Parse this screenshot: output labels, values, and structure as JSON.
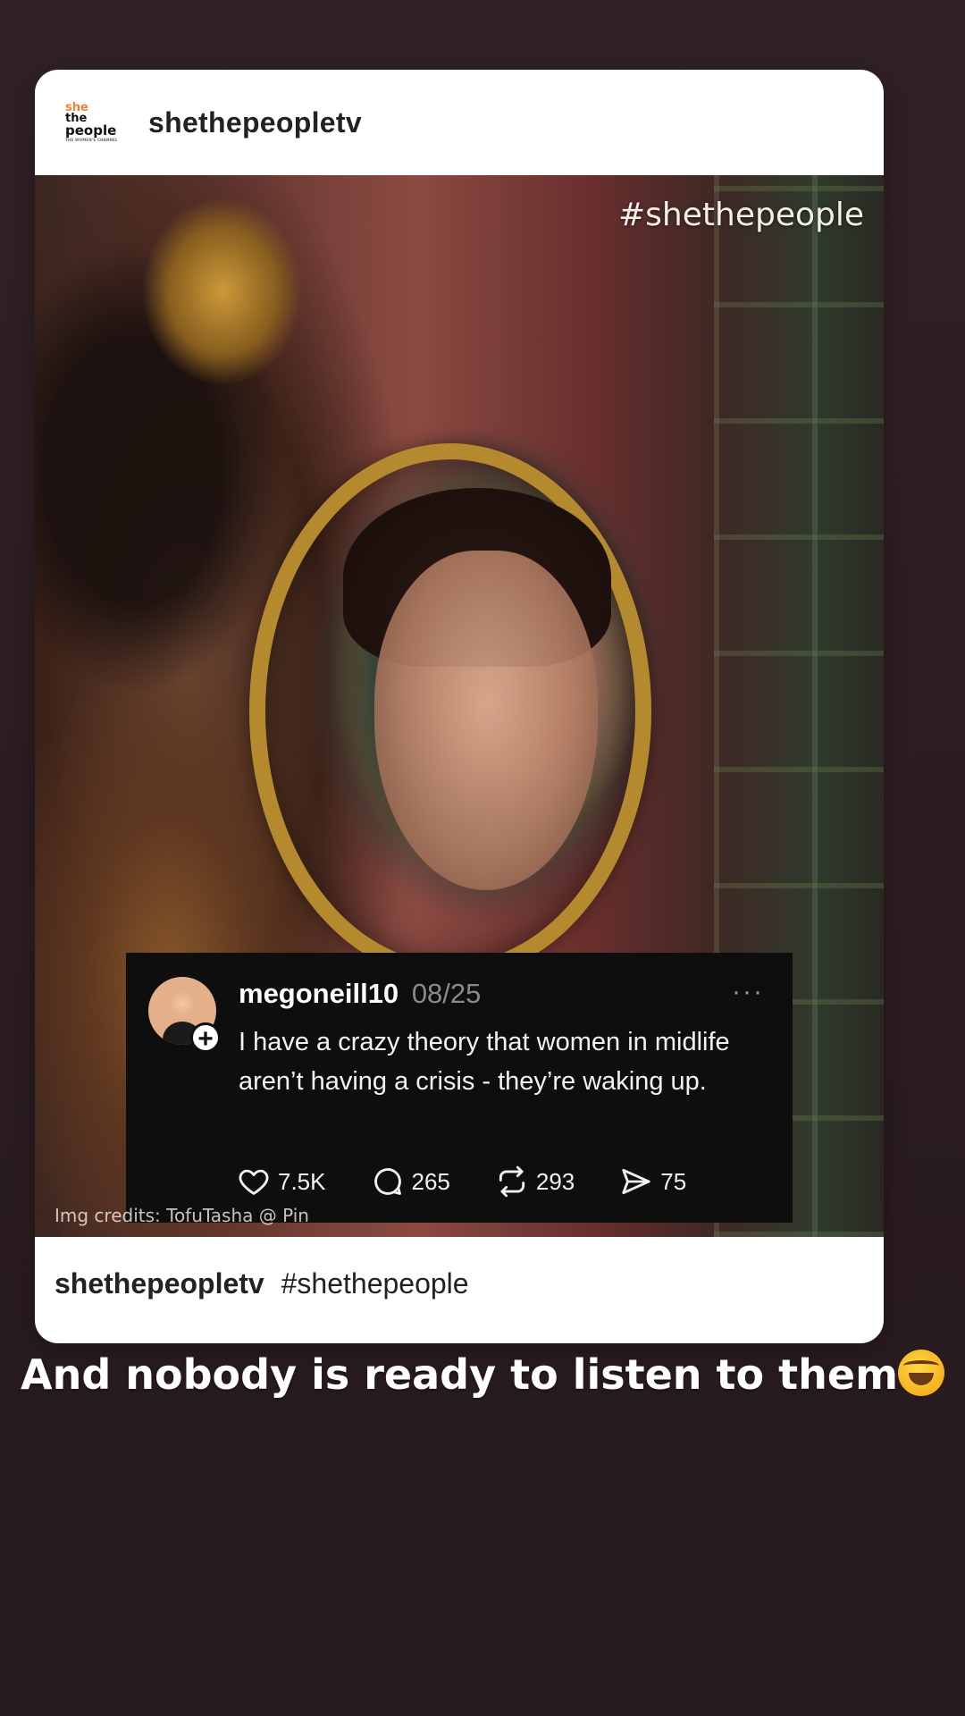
{
  "post": {
    "brand_logo_lines": [
      "she",
      "the",
      "people",
      "THE WOMEN'S CHANNEL"
    ],
    "handle": "shethepeopletv",
    "image_hashtag": "#shethepeople",
    "image_credits": "Img credits: TofuTasha @ Pin",
    "caption_handle": "shethepeopletv",
    "caption_tag": "#shethepeople"
  },
  "thread": {
    "username": "megoneill10",
    "date": "08/25",
    "more_label": "···",
    "add_label": "+",
    "text": "I have a crazy theory that women in midlife aren’t having a crisis - they’re waking up.",
    "likes": "7.5K",
    "comments": "265",
    "reposts": "293",
    "shares": "75"
  },
  "story": {
    "text": "And nobody is ready to listen to them",
    "emoji": "rolling-on-the-floor-laughing-emoji"
  }
}
